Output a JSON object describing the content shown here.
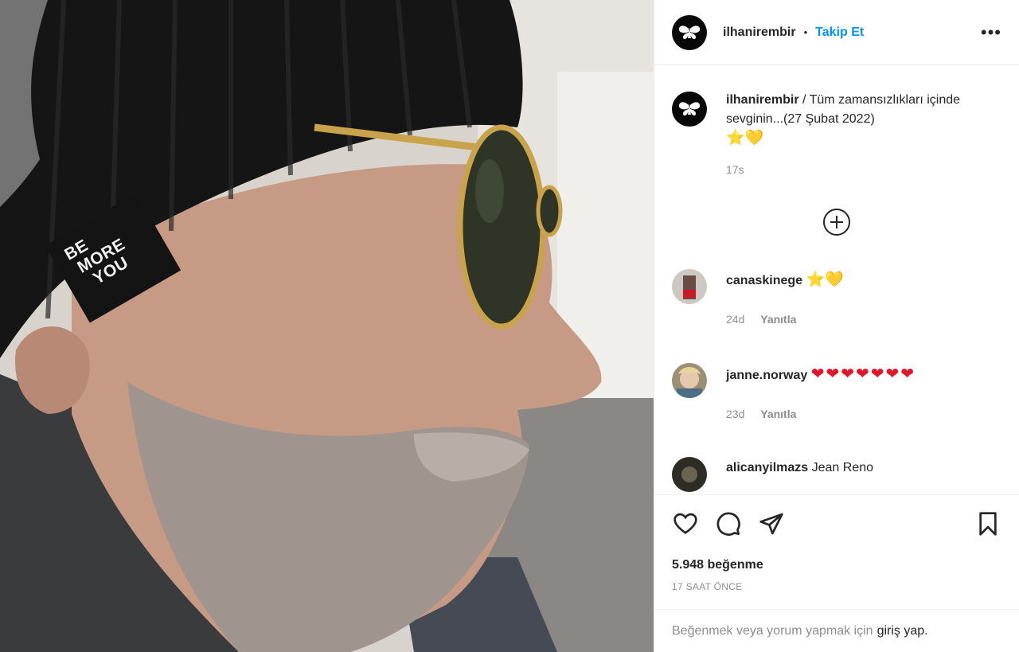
{
  "post": {
    "username": "ilhanirembir",
    "separator": "•",
    "follow_label": "Takip Et",
    "more_label": "•••",
    "photo_label_lines": [
      "BE",
      "MORE",
      "YOU"
    ]
  },
  "caption": {
    "username": "ilhanirembir",
    "text": "/ Tüm zamansızlıkları içinde sevginin...(27 Şubat 2022)",
    "emojis": "⭐💛",
    "time": "17s"
  },
  "comments": [
    {
      "username": "canaskinege",
      "text": "⭐💛",
      "time": "24d",
      "reply_label": "Yanıtla"
    },
    {
      "username": "janne.norway",
      "text": "❤❤❤❤❤❤❤",
      "time": "23d",
      "reply_label": "Yanıtla"
    },
    {
      "username": "alicanyilmazs",
      "text": "Jean Reno"
    }
  ],
  "stats": {
    "likes": "5.948 beğenme",
    "when": "17 SAAT ÖNCE"
  },
  "login": {
    "prompt": "Beğenmek veya yorum yapmak için",
    "link": "giriş yap."
  },
  "colors": {
    "accent": "#0095f6",
    "text": "#262626",
    "muted": "#8e8e8e",
    "heart_red": "#e0162b",
    "star_yellow": "#f5b800"
  },
  "icons": [
    "heart-icon",
    "comment-icon",
    "share-icon",
    "bookmark-icon",
    "add-comment-icon",
    "more-icon"
  ]
}
